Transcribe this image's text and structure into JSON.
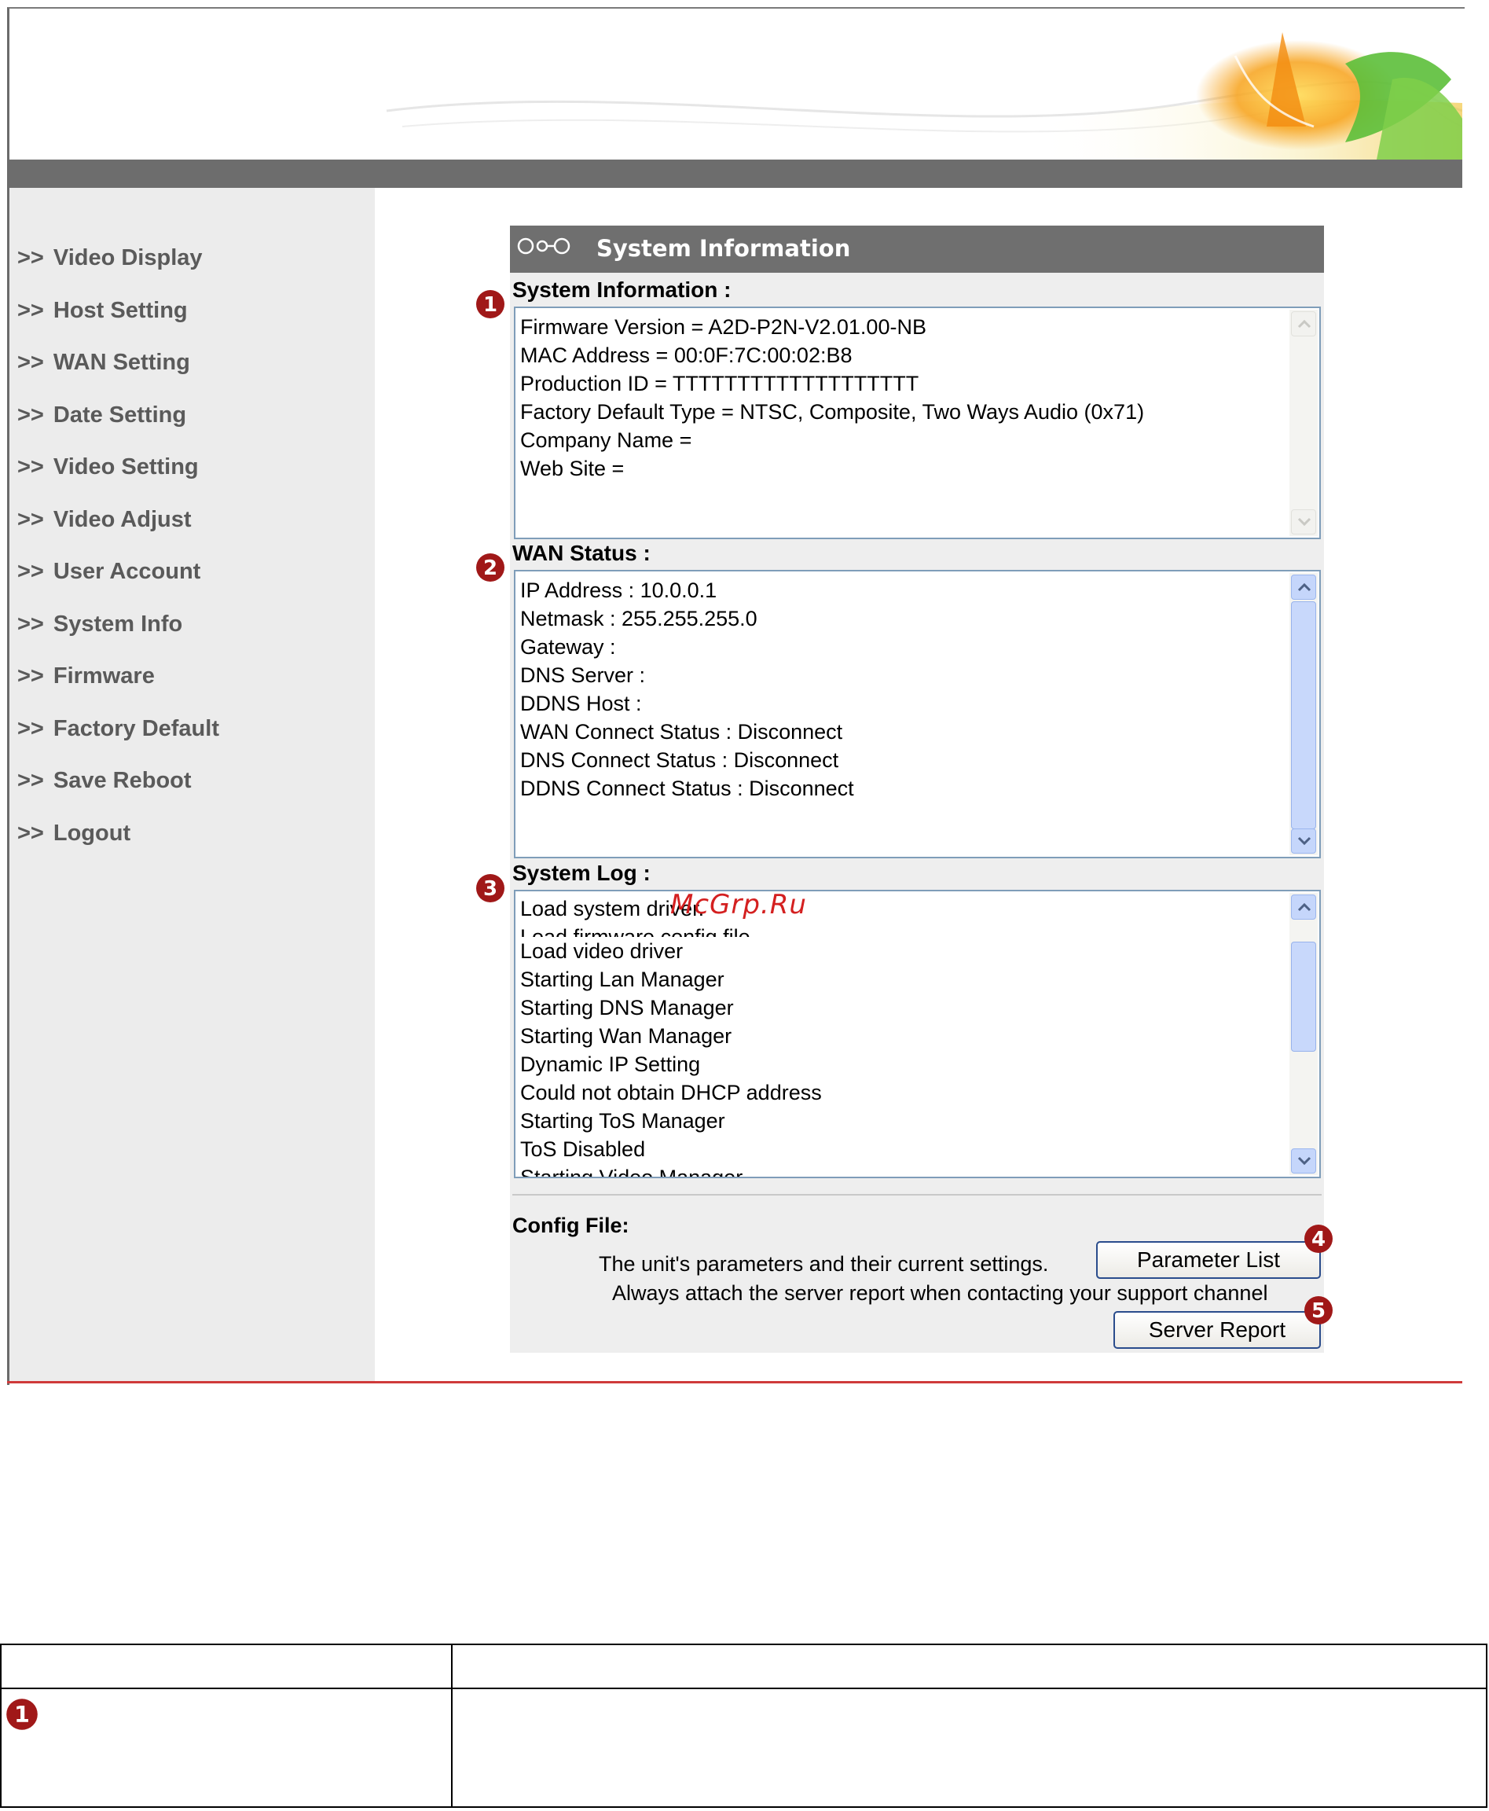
{
  "sidebar": {
    "items": [
      {
        "label": "Video Display"
      },
      {
        "label": "Host Setting"
      },
      {
        "label": "WAN Setting"
      },
      {
        "label": "Date Setting"
      },
      {
        "label": "Video Setting"
      },
      {
        "label": "Video Adjust"
      },
      {
        "label": "User Account"
      },
      {
        "label": "System Info"
      },
      {
        "label": "Firmware"
      },
      {
        "label": "Factory Default"
      },
      {
        "label": "Save Reboot"
      },
      {
        "label": "Logout"
      }
    ],
    "prefix": ">>"
  },
  "panel": {
    "title": "System Information",
    "header_icon": "link-rings-icon"
  },
  "system_information": {
    "label": "System Information :",
    "callout": "1",
    "lines": [
      "Firmware Version = A2D-P2N-V2.01.00-NB",
      "MAC Address = 00:0F:7C:00:02:B8",
      "Production ID = TTTTTTTTTTTTTTTTTTT",
      "Factory Default Type = NTSC, Composite, Two Ways Audio (0x71)",
      "Company Name =",
      "Web Site ="
    ]
  },
  "wan_status": {
    "label": "WAN Status :",
    "callout": "2",
    "lines": [
      "IP Address : 10.0.0.1",
      "Netmask : 255.255.255.0",
      "Gateway :",
      "DNS Server :",
      "DDNS Host :",
      "WAN Connect Status : Disconnect",
      "DNS Connect Status : Disconnect",
      "DDNS Connect Status : Disconnect"
    ]
  },
  "system_log": {
    "label": "System Log :",
    "callout": "3",
    "lines": [
      "Load system driver.",
      "Load firmware config file",
      "Load video driver",
      "Starting Lan Manager",
      "Starting DNS Manager",
      "Starting Wan Manager",
      "Dynamic IP Setting",
      "Could not obtain DHCP address",
      "Starting ToS Manager",
      "ToS Disabled",
      "Starting Video Manager"
    ]
  },
  "config_file": {
    "label": "Config File:",
    "parameters_note": "The unit's parameters and their current settings.",
    "parameter_list_button": "Parameter List",
    "parameter_callout": "4",
    "report_note": "Always attach the server report when contacting your support channel",
    "server_report_button": "Server Report",
    "report_callout": "5"
  },
  "watermark": "McGrp.Ru",
  "doc_table": {
    "row_callout": "1"
  },
  "colors": {
    "nav_bar": "#6d6d6d",
    "sidebar_bg": "#ececec",
    "panel_header": "#6f6f6f",
    "callout": "#a01818",
    "bottom_rule": "#cf3a3a",
    "watermark": "#d42020"
  }
}
